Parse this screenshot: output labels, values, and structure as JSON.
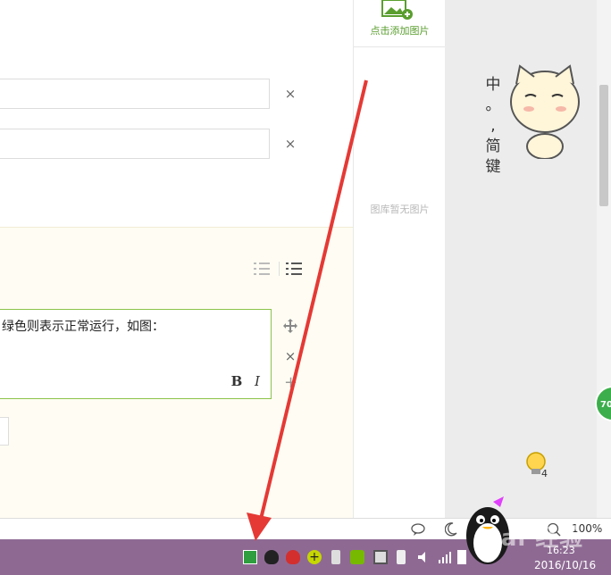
{
  "editor": {
    "step_text": "绿色则表示正常运行，如图：",
    "bold_label": "B",
    "italic_label": "I",
    "remove_glyph": "×",
    "add_glyph": "+"
  },
  "image_panel": {
    "add_image_label": "点击添加图片",
    "empty_label": "图库暂无图片"
  },
  "desktop": {
    "ime_status": [
      "中",
      "。",
      ",",
      "简",
      "键"
    ],
    "badge_count": "4",
    "green_circle_text": "70"
  },
  "status_bar": {
    "zoom": "100%"
  },
  "taskbar": {
    "time": "16:23",
    "date": "2016/10/16",
    "watermark": "Bai 经验",
    "tray_icons": [
      "app-green-icon",
      "qq-icon",
      "qq-red-icon",
      "plus-icon",
      "usb-icon",
      "nvidia-icon",
      "window-icon",
      "phone-icon",
      "volume-icon",
      "signal-icon",
      "network-icon"
    ]
  },
  "colors": {
    "accent_green": "#8bc34a",
    "arrow_red": "#e53935",
    "taskbar": "#8e6a93"
  }
}
